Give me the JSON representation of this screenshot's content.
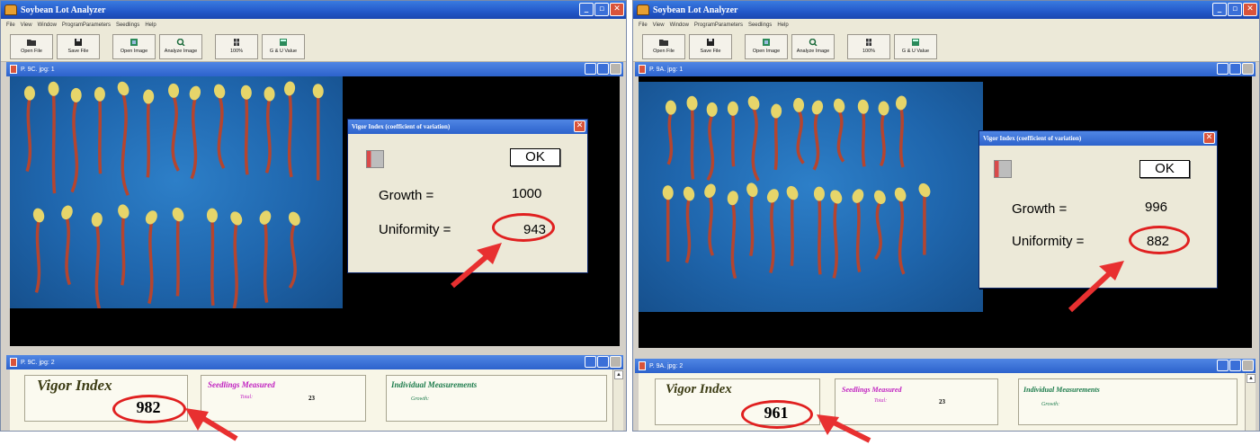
{
  "left": {
    "title": "Soybean Lot Analyzer",
    "menu": [
      "File",
      "View",
      "Window",
      "ProgramParameters",
      "Seedlings",
      "Help"
    ],
    "toolbar": [
      "Open File",
      "Save File",
      "Open Image",
      "Analyze Image",
      "100%",
      "G & U Value"
    ],
    "image_window_title": "P. 9C. jpg: 1",
    "dialog": {
      "title": "Vigor Index (coefficient of variation)",
      "ok": "OK",
      "growth_label": "Growth =",
      "growth_value": "1000",
      "uniformity_label": "Uniformity =",
      "uniformity_value": "943"
    },
    "results_window_title": "P. 9C. jpg: 2",
    "vigor_index_label": "Vigor Index",
    "vigor_index_value": "982",
    "seedlings_label": "Seedlings Measured",
    "total_label": "Total:",
    "total_value": "23",
    "individual_label": "Individual Measurements",
    "growth_label": "Growth:"
  },
  "right": {
    "title": "Soybean Lot Analyzer",
    "menu": [
      "File",
      "View",
      "Window",
      "ProgramParameters",
      "Seedlings",
      "Help"
    ],
    "toolbar": [
      "Open File",
      "Save File",
      "Open Image",
      "Analyze Image",
      "100%",
      "G & U Value"
    ],
    "image_window_title": "P. 9A. jpg: 1",
    "dialog": {
      "title": "Vigor Index (coefficient of variation)",
      "ok": "OK",
      "growth_label": "Growth =",
      "growth_value": "996",
      "uniformity_label": "Uniformity =",
      "uniformity_value": "882"
    },
    "results_window_title": "P. 9A. jpg: 2",
    "vigor_index_label": "Vigor Index",
    "vigor_index_value": "961",
    "seedlings_label": "Seedlings Measured",
    "total_label": "Total:",
    "total_value": "23",
    "individual_label": "Individual Measurements",
    "growth_label": "Growth:"
  },
  "colors": {
    "accent_red": "#e02020",
    "seedling_root": "#b5452f",
    "seed_yellow": "#e6d56a",
    "photo_blue": "#1f66ad",
    "seedlings_header": "#c020c0",
    "individual_header": "#1a7a4a"
  }
}
